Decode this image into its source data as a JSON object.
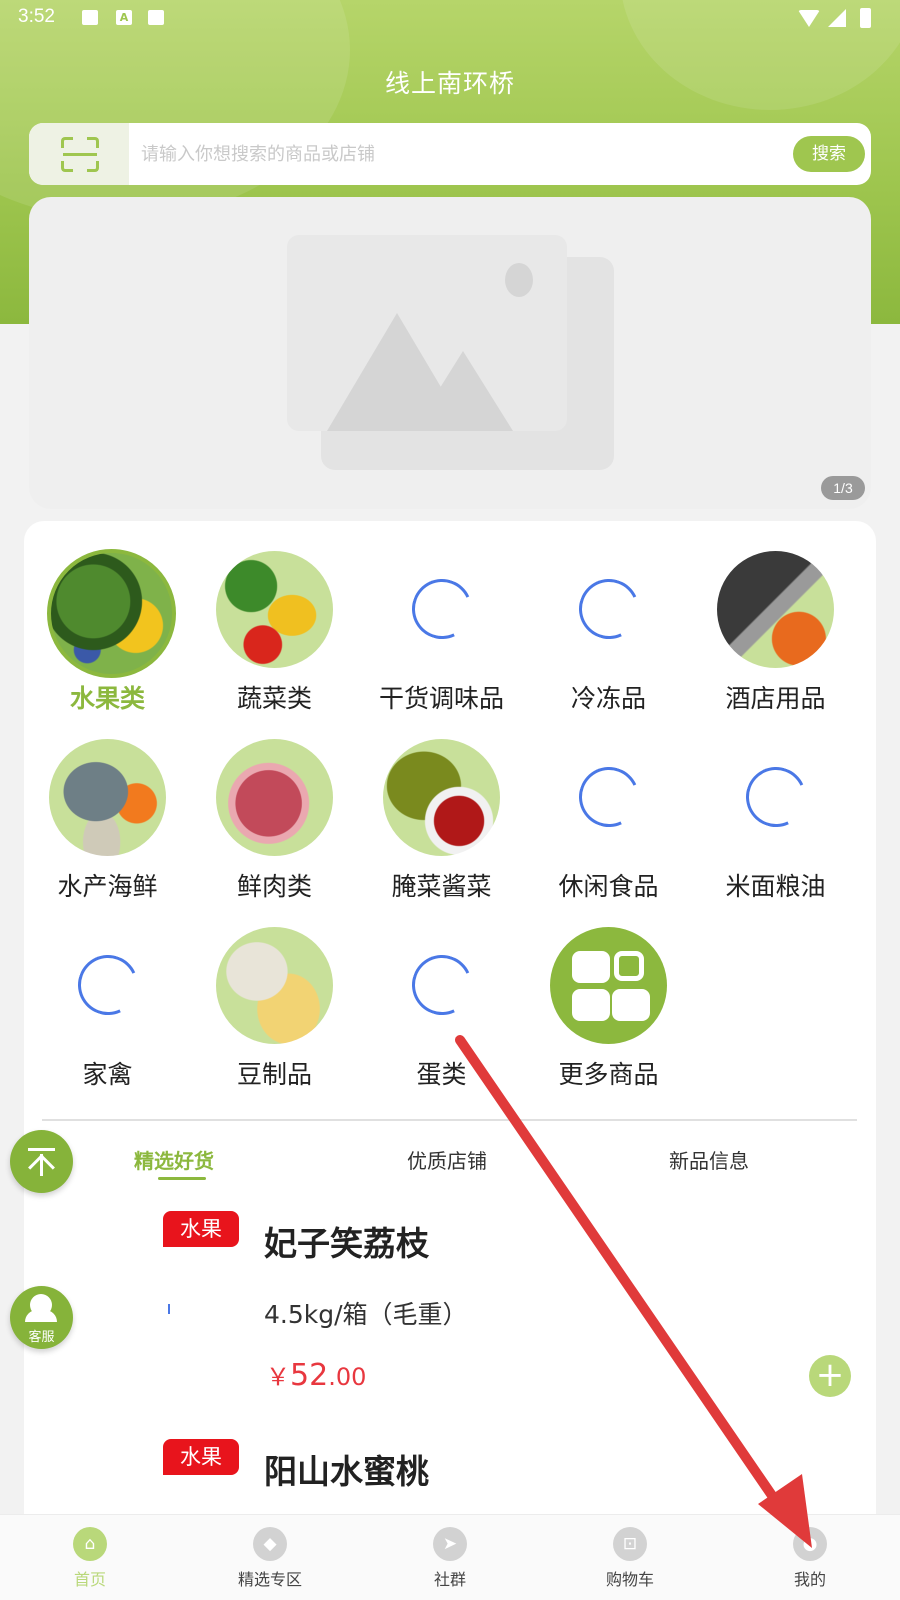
{
  "status_bar": {
    "time": "3:52",
    "a_icon": "A"
  },
  "app_title": "线上南环桥",
  "search": {
    "placeholder": "请输入你想搜索的商品或店铺",
    "value": "",
    "button_label": "搜索"
  },
  "banner": {
    "page_indicator": "1/3"
  },
  "categories": [
    {
      "label": "水果类"
    },
    {
      "label": "蔬菜类"
    },
    {
      "label": "干货调味品"
    },
    {
      "label": "冷冻品"
    },
    {
      "label": "酒店用品"
    },
    {
      "label": "水产海鲜"
    },
    {
      "label": "鲜肉类"
    },
    {
      "label": "腌菜酱菜"
    },
    {
      "label": "休闲食品"
    },
    {
      "label": "米面粮油"
    },
    {
      "label": "家禽"
    },
    {
      "label": "豆制品"
    },
    {
      "label": "蛋类"
    },
    {
      "label": "更多商品"
    }
  ],
  "tabs": [
    {
      "label": "精选好货"
    },
    {
      "label": "优质店铺"
    },
    {
      "label": "新品信息"
    }
  ],
  "products": [
    {
      "tag": "水果",
      "name": "妃子笑荔枝",
      "spec": "4.5kg/箱（毛重）",
      "price_symbol": "￥",
      "price_int": "52",
      "price_dec": ".00"
    },
    {
      "tag": "水果",
      "name": "阳山水蜜桃"
    }
  ],
  "floating": {
    "service_label": "客服"
  },
  "bottom_nav": [
    {
      "label": "首页"
    },
    {
      "label": "精选专区"
    },
    {
      "label": "社群"
    },
    {
      "label": "购物车"
    },
    {
      "label": "我的"
    }
  ],
  "colors": {
    "brand_green": "#8cb83e",
    "tag_red": "#e8141c",
    "price_red": "#e8373f",
    "annotation_arrow": "#e03a3a"
  }
}
